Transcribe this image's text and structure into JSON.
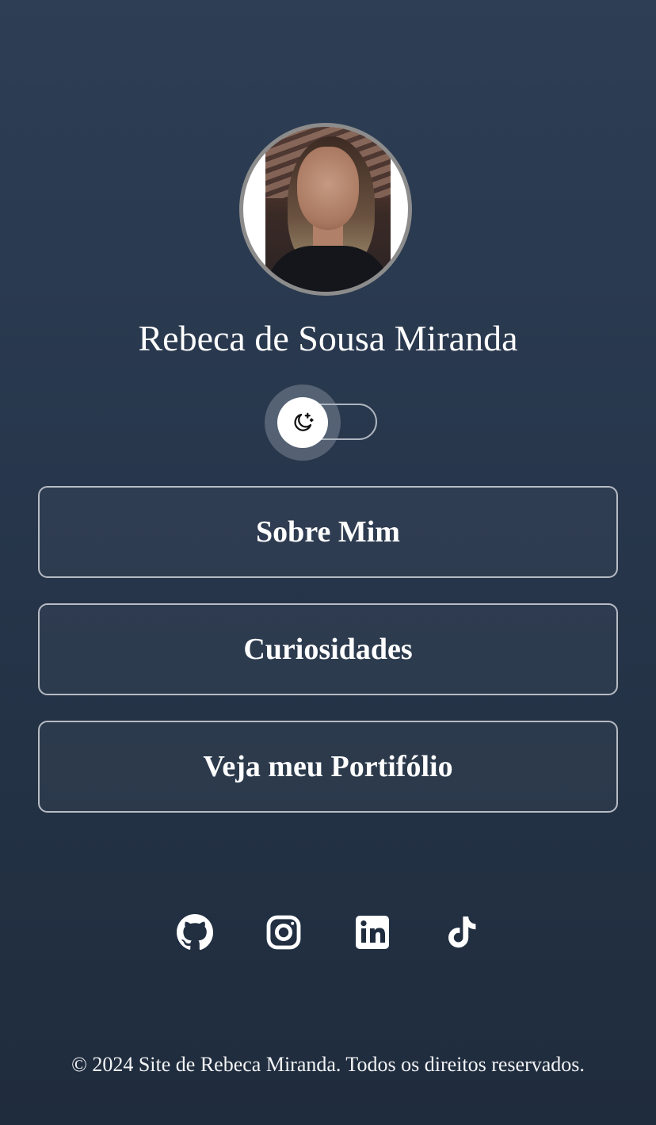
{
  "profile": {
    "name": "Rebeca de Sousa Miranda",
    "avatar_alt": "profile-photo"
  },
  "theme_toggle": {
    "icon": "moon-stars-icon",
    "state": "dark"
  },
  "nav": {
    "buttons": [
      {
        "label": "Sobre Mim"
      },
      {
        "label": "Curiosidades"
      },
      {
        "label": "Veja meu Portifólio"
      }
    ]
  },
  "social": {
    "icons": [
      "github-icon",
      "instagram-icon",
      "linkedin-icon",
      "tiktok-icon"
    ]
  },
  "footer": {
    "text": "© 2024 Site de Rebeca Miranda. Todos os direitos reservados."
  },
  "colors": {
    "background_top": "#2d3e55",
    "background_bottom": "#1f2c3d",
    "button_border": "#b7bcc4",
    "text": "#ffffff"
  }
}
